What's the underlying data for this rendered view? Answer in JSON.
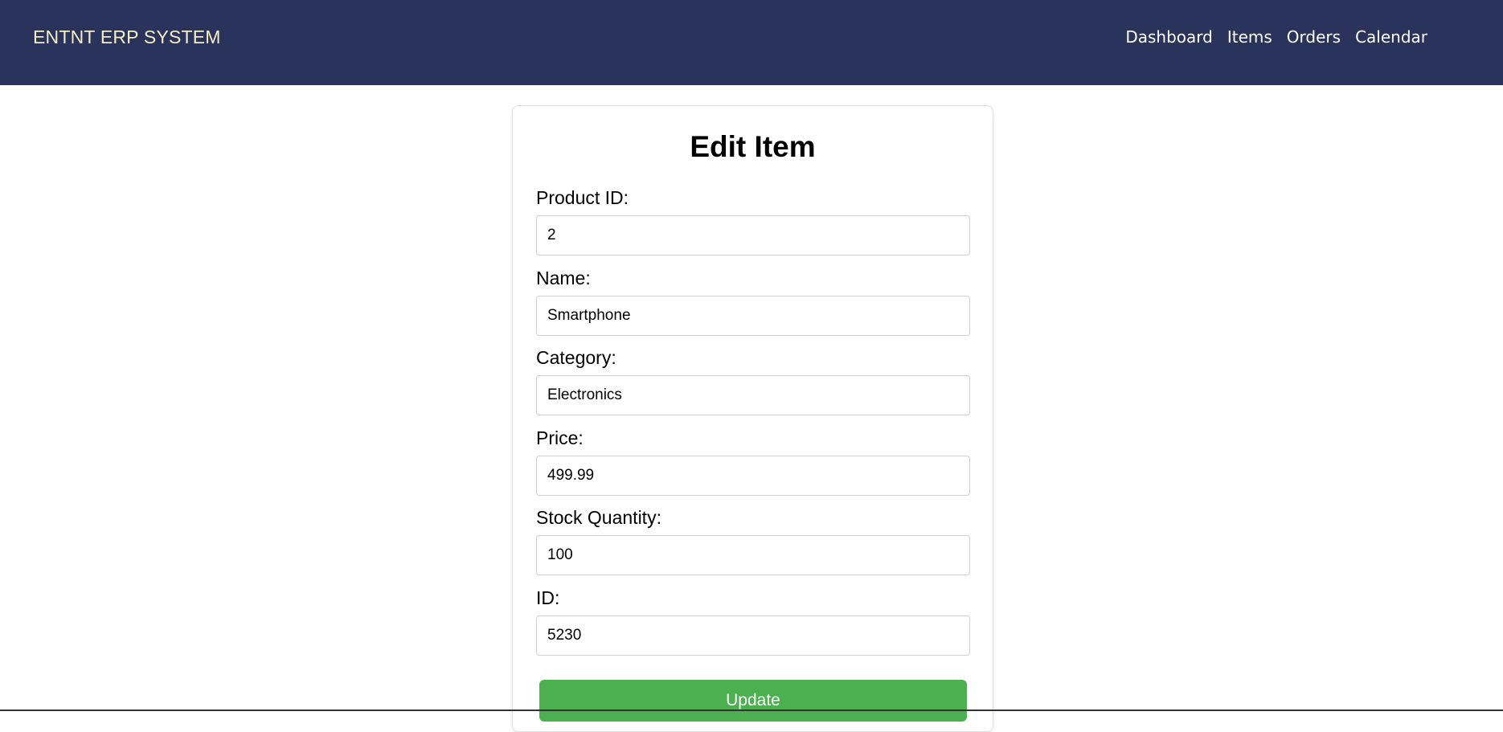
{
  "header": {
    "brand": "ENTNT ERP SYSTEM",
    "nav": [
      {
        "label": "Dashboard"
      },
      {
        "label": "Items"
      },
      {
        "label": "Orders"
      },
      {
        "label": "Calendar"
      }
    ]
  },
  "form": {
    "title": "Edit Item",
    "fields": [
      {
        "label": "Product ID:",
        "value": "2"
      },
      {
        "label": "Name:",
        "value": "Smartphone"
      },
      {
        "label": "Category:",
        "value": "Electronics"
      },
      {
        "label": "Price:",
        "value": "499.99"
      },
      {
        "label": "Stock Quantity:",
        "value": "100"
      },
      {
        "label": "ID:",
        "value": "5230"
      }
    ],
    "submit_label": "Update"
  },
  "colors": {
    "nav_bg": "#29335c",
    "brand_text": "#f4eec3",
    "button_bg": "#4caf50"
  }
}
